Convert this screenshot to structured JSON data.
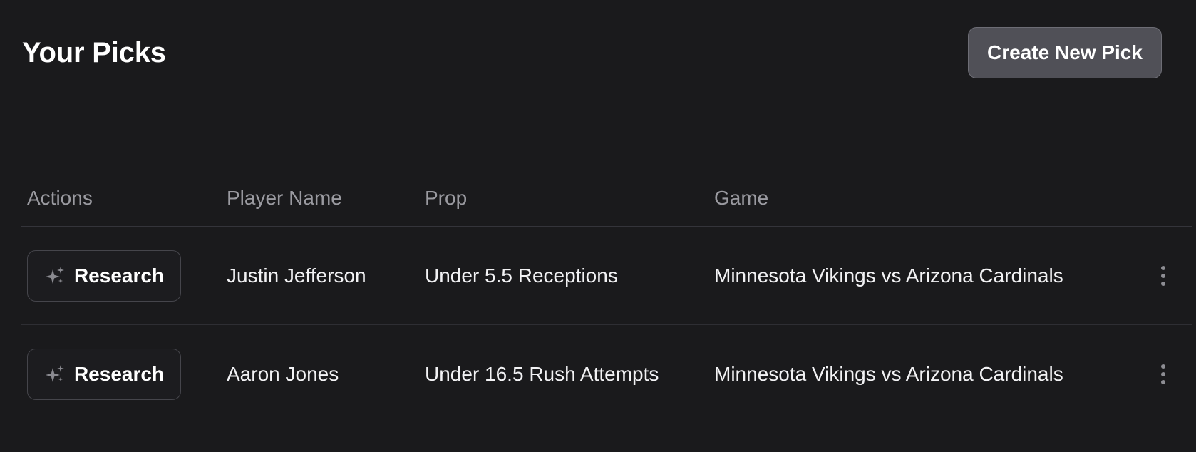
{
  "header": {
    "title": "Your Picks",
    "create_button": "Create New Pick"
  },
  "table": {
    "columns": [
      "Actions",
      "Player Name",
      "Prop",
      "Game"
    ],
    "rows": [
      {
        "action_label": "Research",
        "player": "Justin Jefferson",
        "prop": "Under 5.5 Receptions",
        "game": "Minnesota Vikings vs Arizona Cardinals"
      },
      {
        "action_label": "Research",
        "player": "Aaron Jones",
        "prop": "Under 16.5 Rush Attempts",
        "game": "Minnesota Vikings vs Arizona Cardinals"
      }
    ]
  },
  "icons": {
    "research": "sparkle-icon",
    "row_menu": "more-vertical-icon"
  },
  "colors": {
    "background": "#1a1a1c",
    "primary_button": "#505057",
    "header_text": "#9a9aa0"
  }
}
